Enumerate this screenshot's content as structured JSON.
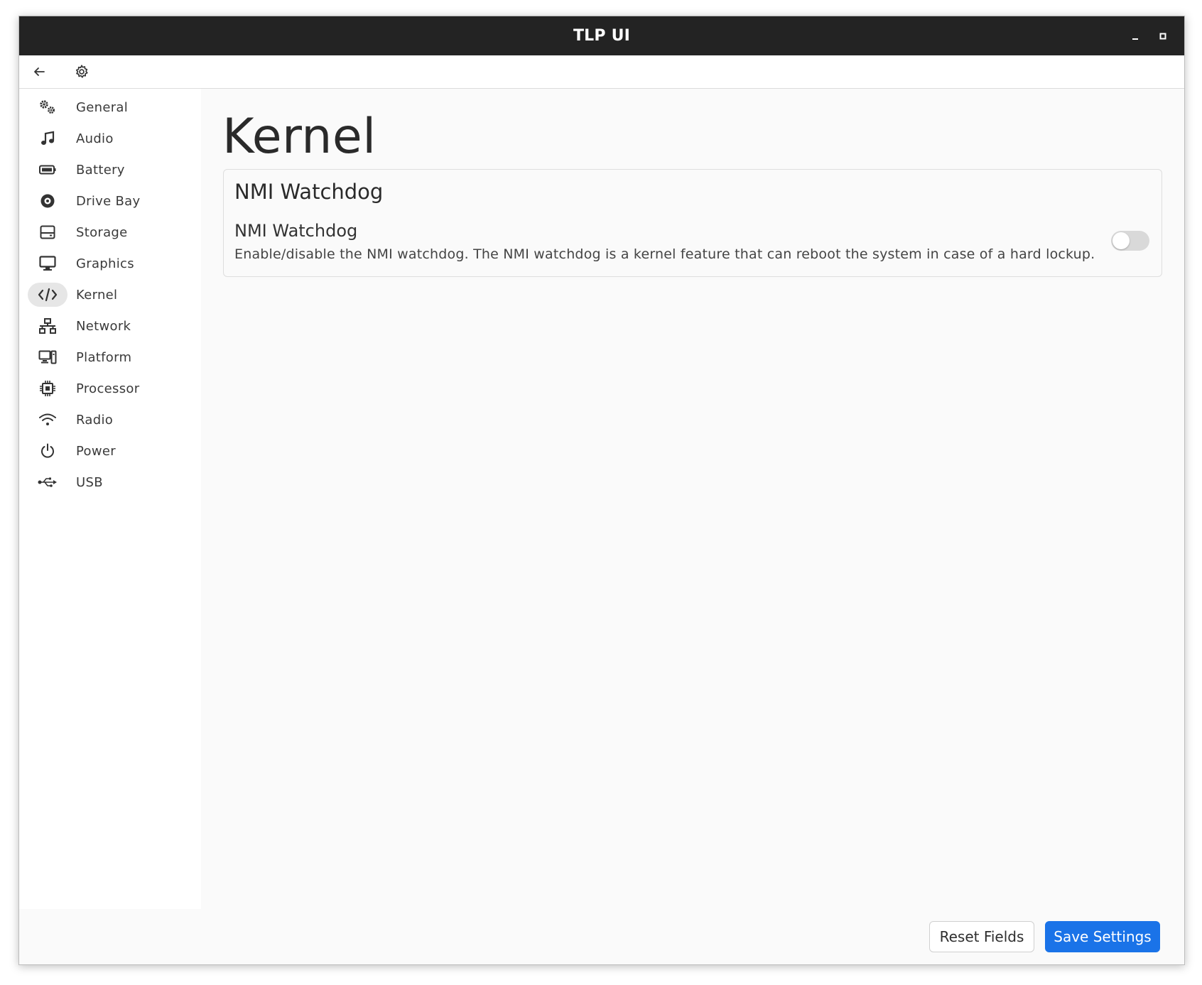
{
  "window": {
    "title": "TLP UI"
  },
  "toolbar": {
    "back_icon": "arrow-left-icon",
    "settings_icon": "gear-icon"
  },
  "sidebar": {
    "items": [
      {
        "label": "General",
        "icon": "gears-icon",
        "active": false
      },
      {
        "label": "Audio",
        "icon": "music-note-icon",
        "active": false
      },
      {
        "label": "Battery",
        "icon": "battery-icon",
        "active": false
      },
      {
        "label": "Drive Bay",
        "icon": "disc-icon",
        "active": false
      },
      {
        "label": "Storage",
        "icon": "hard-drive-icon",
        "active": false
      },
      {
        "label": "Graphics",
        "icon": "monitor-icon",
        "active": false
      },
      {
        "label": "Kernel",
        "icon": "code-icon",
        "active": true
      },
      {
        "label": "Network",
        "icon": "network-icon",
        "active": false
      },
      {
        "label": "Platform",
        "icon": "desktop-tower-icon",
        "active": false
      },
      {
        "label": "Processor",
        "icon": "cpu-chip-icon",
        "active": false
      },
      {
        "label": "Radio",
        "icon": "wifi-icon",
        "active": false
      },
      {
        "label": "Power",
        "icon": "power-icon",
        "active": false
      },
      {
        "label": "USB",
        "icon": "usb-icon",
        "active": false
      }
    ]
  },
  "main": {
    "page_title": "Kernel",
    "card": {
      "title": "NMI Watchdog",
      "setting": {
        "title": "NMI Watchdog",
        "description": "Enable/disable the NMI watchdog. The NMI watchdog is a kernel feature that can reboot the system in case of a hard lockup.",
        "enabled": false
      }
    }
  },
  "footer": {
    "reset_label": "Reset Fields",
    "save_label": "Save Settings"
  },
  "colors": {
    "titlebar": "#232323",
    "accent": "#1a73e8",
    "active_item_bg": "#e6e6e6",
    "toggle_off": "#d9d9d9"
  }
}
